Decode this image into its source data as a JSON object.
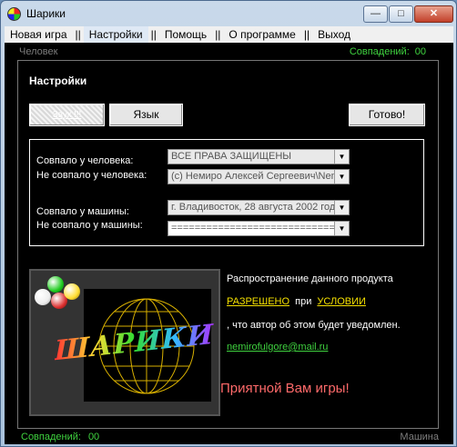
{
  "window": {
    "title": "Шарики"
  },
  "menu": {
    "items": [
      "Новая игра",
      "Настройки",
      "Помощь",
      "О программе",
      "Выход"
    ],
    "separator": "||"
  },
  "top": {
    "player": "Человек",
    "score_label": "Совпадений:",
    "score": "00"
  },
  "bottom": {
    "score_label": "Совпадений:",
    "score": "00",
    "player": "Машина"
  },
  "settings": {
    "title": "Настройки",
    "sound_label": "Звук !!!",
    "language_label": "Язык",
    "done_label": "Готово!",
    "rows": [
      {
        "label": "Совпало у человека:",
        "value": "ВСЕ ПРАВА ЗАЩИЩЕНЫ"
      },
      {
        "label": "Не совпало у человека:",
        "value": "(c) Немиро Алексей Сергеевич\\Nem"
      },
      {
        "label": "Совпало у машины:",
        "value": "г. Владивосток, 28 августа 2002 года"
      },
      {
        "label": "Не совпало у машины:",
        "value": "======================================"
      }
    ]
  },
  "about": {
    "line1": "Распространение данного продукта",
    "allowed": "РАЗРЕШЕНО",
    "on": "при",
    "condition": "УСЛОВИИ",
    "line3": ", что автор об этом будет уведомлен.",
    "email": "nemirofulgore@mail.ru",
    "enjoy": "Приятной Вам игры!",
    "logo_text": "ШАРИКИ"
  },
  "colors": {
    "score_green": "#3fd23f",
    "link_yellow": "#f5e000",
    "enjoy_red": "#ff6a6a"
  }
}
